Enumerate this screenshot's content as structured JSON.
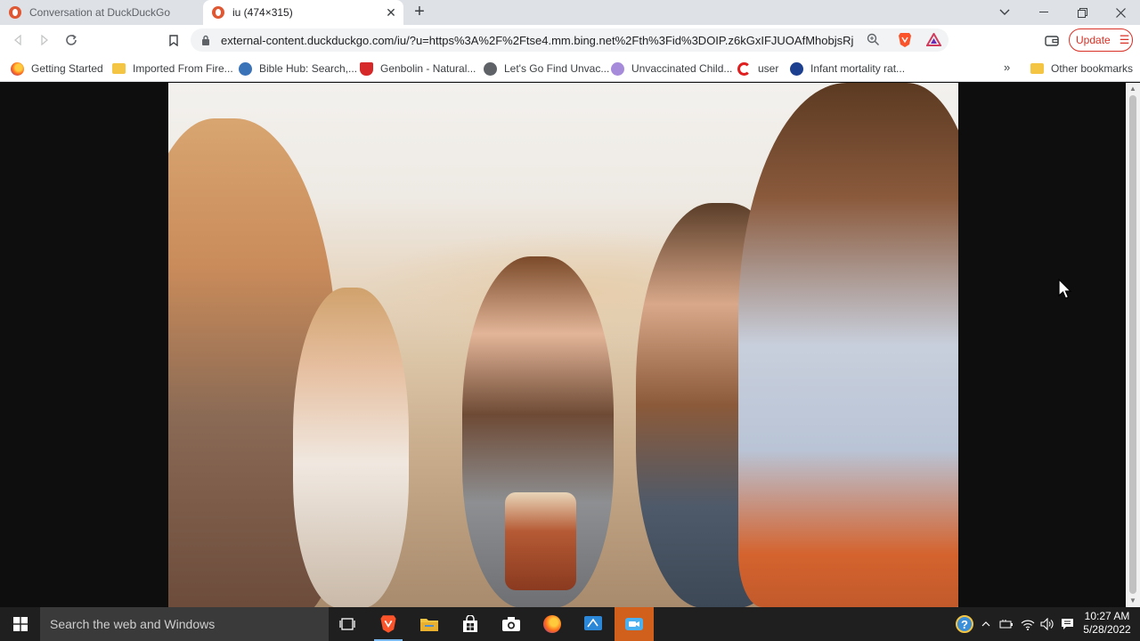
{
  "tabs": [
    {
      "title": "Conversation at DuckDuckGo",
      "active": false
    },
    {
      "title": "iu (474×315)",
      "active": true
    }
  ],
  "toolbar": {
    "url": "external-content.duckduckgo.com/iu/?u=https%3A%2F%2Ftse4.mm.bing.net%2Fth%3Fid%3DOIP.z6kGxIFJUOAfMhobjsRj...",
    "update_label": "Update"
  },
  "bookmarks": [
    {
      "label": "Getting Started",
      "icon": "firefox-icon"
    },
    {
      "label": "Imported From Fire...",
      "icon": "folder-icon"
    },
    {
      "label": "Bible Hub: Search,...",
      "icon": "globe-icon"
    },
    {
      "label": "Genbolin - Natural...",
      "icon": "flask-icon"
    },
    {
      "label": "Let's Go Find Unvac...",
      "icon": "globe-icon"
    },
    {
      "label": "Unvaccinated Child...",
      "icon": "chat-icon"
    },
    {
      "label": "user",
      "icon": "c-logo-icon"
    },
    {
      "label": "Infant mortality rat...",
      "icon": "s-logo-icon"
    }
  ],
  "other_bookmarks": "Other bookmarks",
  "taskbar": {
    "search_placeholder": "Search the web and Windows",
    "time": "10:27 AM",
    "date": "5/28/2022"
  },
  "colors": {
    "accent_red": "#d93025",
    "taskbar_active": "#d1601c",
    "ddg_orange": "#de5833"
  }
}
